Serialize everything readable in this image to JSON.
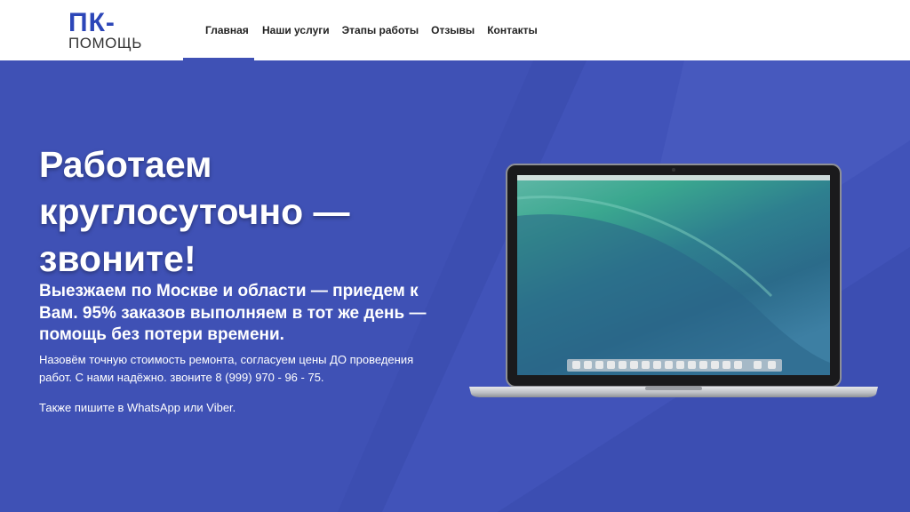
{
  "logo": {
    "top": "ПК-",
    "bottom": "ПОМОЩЬ"
  },
  "nav": {
    "items": [
      {
        "label": "Главная",
        "active": true
      },
      {
        "label": "Наши услуги"
      },
      {
        "label": "Этапы работы"
      },
      {
        "label": "Отзывы"
      },
      {
        "label": "Контакты"
      }
    ]
  },
  "hero": {
    "title": "Работаем круглосуточно — звоните!",
    "subtitle": "Выезжаем по Москве и области — приедем к Вам. 95% заказов выполняем в тот же день — помощь без потери времени.",
    "description": "Назовём точную стоимость ремонта, согласуем цены ДО проведения работ. С нами надёжно. звоните 8 (999) 970 - 96 - 75.",
    "extra": "Также пишите в WhatsApp или Viber."
  },
  "colors": {
    "accent": "#3f51b5",
    "logo": "#2c46b8"
  },
  "icons": {
    "laptop": "macbook-laptop-image"
  }
}
